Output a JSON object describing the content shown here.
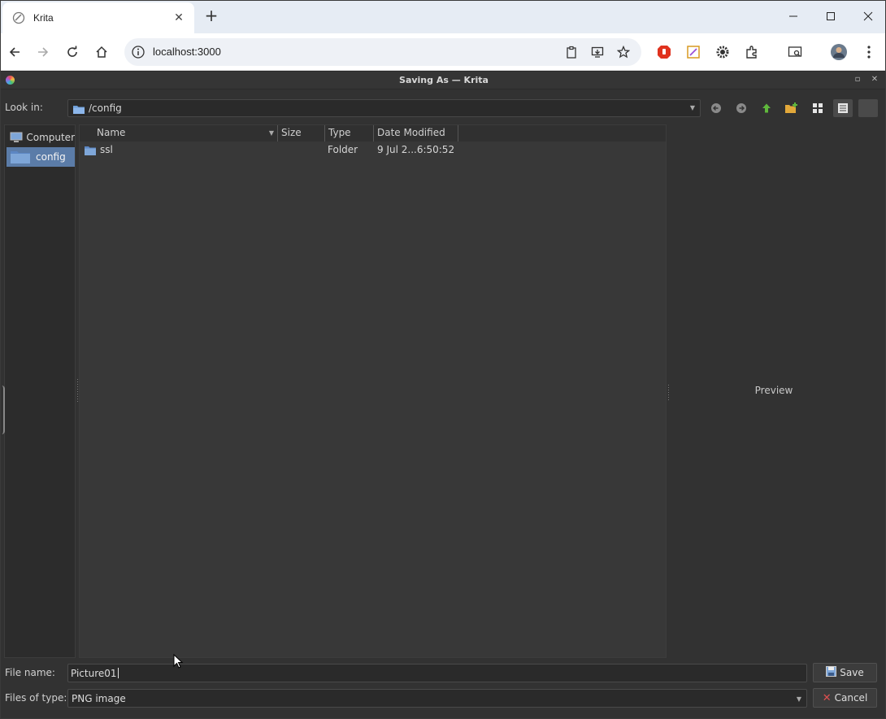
{
  "browser": {
    "tab_title": "Krita",
    "url": "localhost:3000",
    "accent": "#e6ecf4"
  },
  "dialog": {
    "title": "Saving As — Krita",
    "look_in_label": "Look in:",
    "look_in_path": "/config",
    "places": [
      {
        "label": "Computer",
        "icon": "computer-icon"
      },
      {
        "label": "config",
        "icon": "folder-icon",
        "selected": true
      }
    ],
    "columns": [
      "Name",
      "Size",
      "Type",
      "Date Modified"
    ],
    "files": [
      {
        "name": "ssl",
        "size": "",
        "type": "Folder",
        "modified": "9 Jul 2...6:50:52"
      }
    ],
    "preview_label": "Preview",
    "file_name_label": "File name:",
    "file_name_value": "Picture01",
    "file_type_label": "Files of type:",
    "file_type_value": "PNG image",
    "save_label": "Save",
    "cancel_label": "Cancel",
    "selection_color": "#5b7ca8"
  }
}
